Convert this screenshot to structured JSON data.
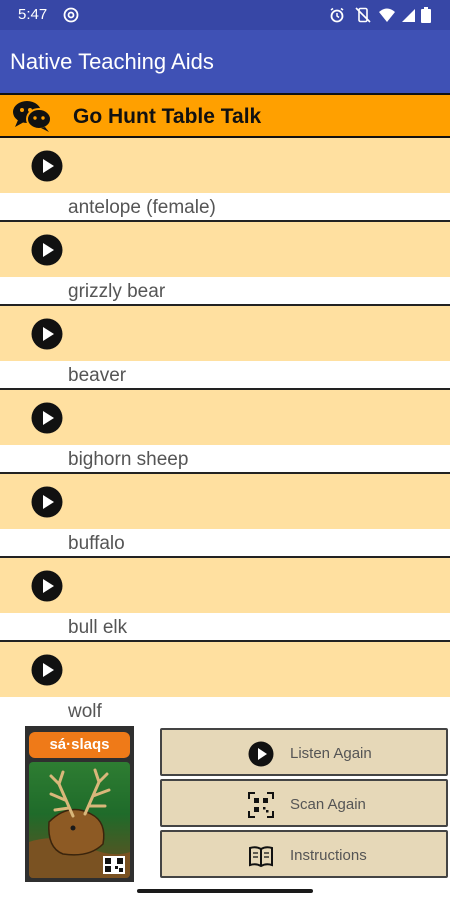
{
  "status_bar": {
    "time": "5:47",
    "icons": [
      "at-sign-icon",
      "alarm-icon",
      "vibrate-off-icon",
      "wifi-icon",
      "signal-icon",
      "battery-icon"
    ]
  },
  "app_bar": {
    "title": "Native Teaching Aids"
  },
  "header": {
    "icon": "chat-bubbles-icon",
    "title": "Go Hunt Table Talk"
  },
  "items": [
    {
      "label": "antelope (female)",
      "icon": "play-icon"
    },
    {
      "label": "grizzly bear",
      "icon": "play-icon"
    },
    {
      "label": "beaver",
      "icon": "play-icon"
    },
    {
      "label": "bighorn sheep",
      "icon": "play-icon"
    },
    {
      "label": "buffalo",
      "icon": "play-icon"
    },
    {
      "label": "bull elk",
      "icon": "play-icon"
    },
    {
      "label": "wolf",
      "icon": "play-icon"
    }
  ],
  "card": {
    "label": "sá·slaqs"
  },
  "actions": [
    {
      "label": "Listen Again",
      "icon": "play-icon"
    },
    {
      "label": "Scan Again",
      "icon": "qr-scan-icon"
    },
    {
      "label": "Instructions",
      "icon": "book-icon"
    }
  ],
  "colors": {
    "status_bar": "#3747a6",
    "app_bar": "#3f51b5",
    "header": "#ffa000",
    "row_top": "#ffe0a0",
    "action_button": "#e6d8b8",
    "card_label": "#ef7a18"
  }
}
